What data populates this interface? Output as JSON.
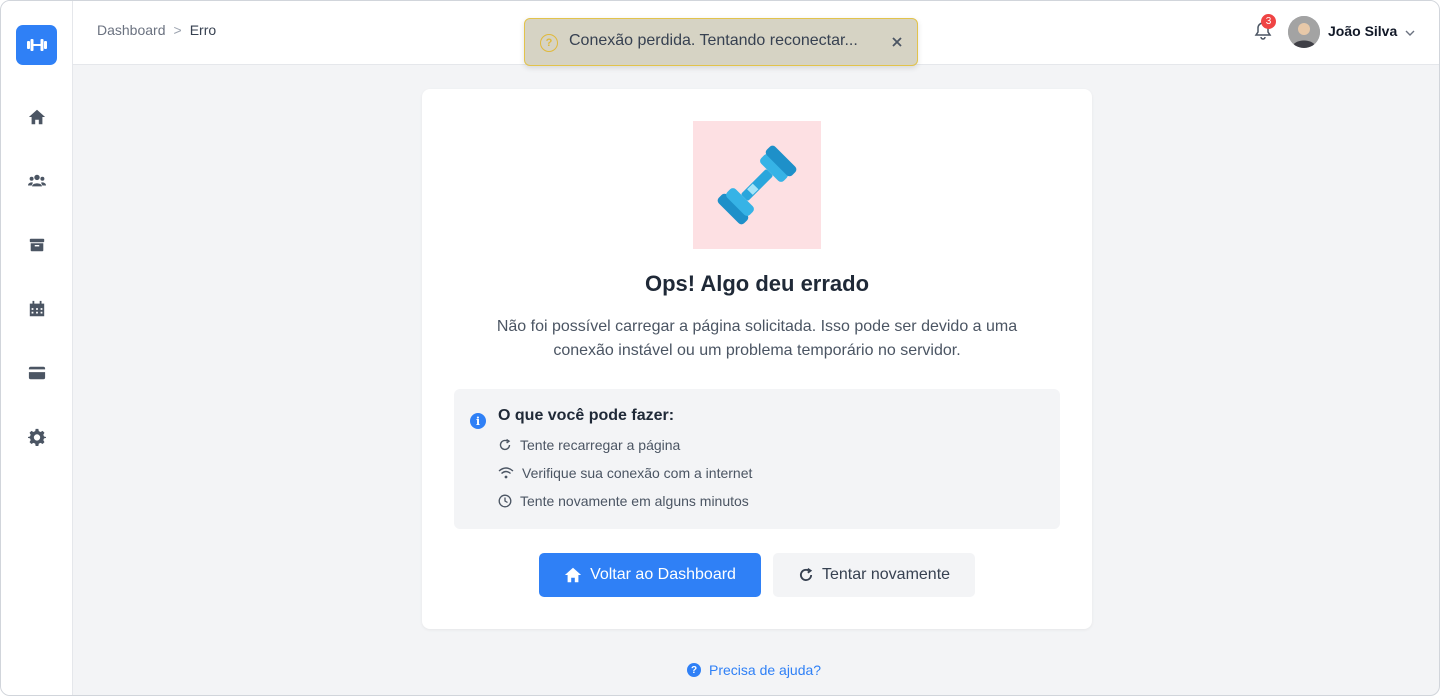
{
  "breadcrumb": {
    "root": "Dashboard",
    "separator": ">",
    "current": "Erro"
  },
  "toast": {
    "message": "Conexão perdida. Tentando reconectar...",
    "icon": "warning-circle-icon",
    "color": "#e0b93b"
  },
  "header": {
    "notifications_count": "3",
    "user_name": "João Silva"
  },
  "sidebar": {
    "items": [
      {
        "name": "home",
        "icon": "home-icon"
      },
      {
        "name": "members",
        "icon": "users-icon"
      },
      {
        "name": "inventory",
        "icon": "archive-icon"
      },
      {
        "name": "calendar",
        "icon": "calendar-icon"
      },
      {
        "name": "payments",
        "icon": "credit-card-icon"
      },
      {
        "name": "settings",
        "icon": "gear-icon"
      }
    ]
  },
  "error": {
    "title": "Ops! Algo deu errado",
    "description": "Não foi possível carregar a página solicitada. Isso pode ser devido a uma conexão instável ou um problema temporário no servidor.",
    "tips_title": "O que você pode fazer:",
    "tips": [
      "Tente recarregar a página",
      "Verifique sua conexão com a internet",
      "Tente novamente em alguns minutos"
    ],
    "primary_button": "Voltar ao Dashboard",
    "secondary_button": "Tentar novamente"
  },
  "help_link": "Precisa de ajuda?",
  "colors": {
    "accent": "#2f80f6",
    "badge": "#ef4444",
    "illustration_bg": "#fde0e3"
  }
}
